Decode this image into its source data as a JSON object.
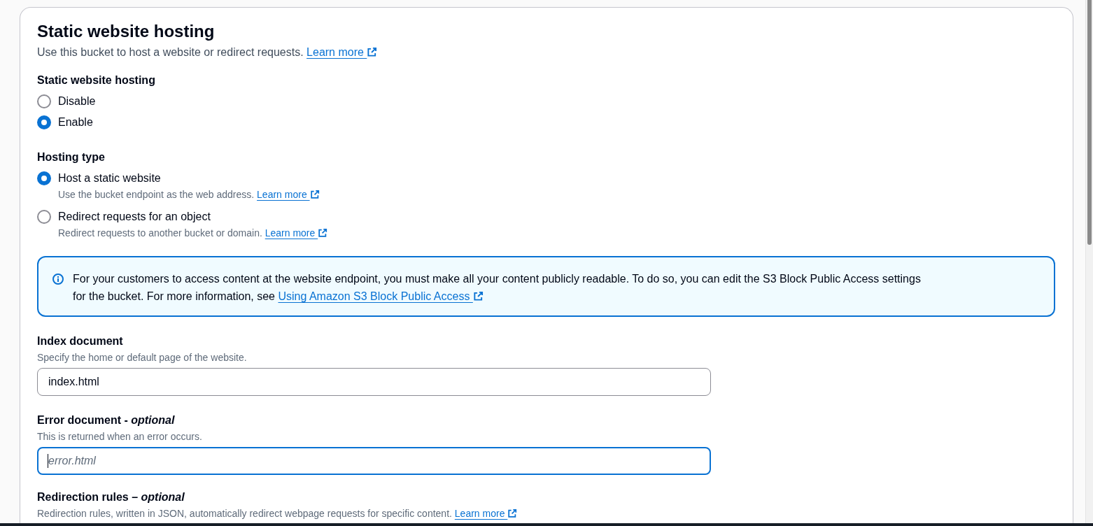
{
  "panel": {
    "title": "Static website hosting",
    "description": "Use this bucket to host a website or redirect requests.",
    "link": "Learn more"
  },
  "hosting_toggle": {
    "label": "Static website hosting",
    "options": [
      {
        "label": "Disable",
        "selected": false
      },
      {
        "label": "Enable",
        "selected": true
      }
    ]
  },
  "hosting_type": {
    "label": "Hosting type",
    "options": [
      {
        "label": "Host a static website",
        "description": "Use the bucket endpoint as the web address.",
        "link": "Learn more",
        "selected": true
      },
      {
        "label": "Redirect requests for an object",
        "description": "Redirect requests to another bucket or domain.",
        "link": "Learn more",
        "selected": false
      }
    ]
  },
  "alert": {
    "text": "For your customers to access content at the website endpoint, you must make all your content publicly readable. To do so, you can edit the S3 Block Public Access settings for the bucket. For more information, see",
    "link": "Using Amazon S3 Block Public Access"
  },
  "fields": [
    {
      "label": "Index document",
      "hint": "Specify the home or default page of the website.",
      "value": "index.html",
      "focused": false
    },
    {
      "label": "Error document - *optional*",
      "hint": "This is returned when an error occurs.",
      "placeholder": "error.html",
      "focused": true
    }
  ],
  "redirection_rules": {
    "label": "Redirection rules – *optional*",
    "hint": "Redirection rules, written in JSON, automatically redirect webpage requests for specific content.",
    "link": "Learn more"
  }
}
